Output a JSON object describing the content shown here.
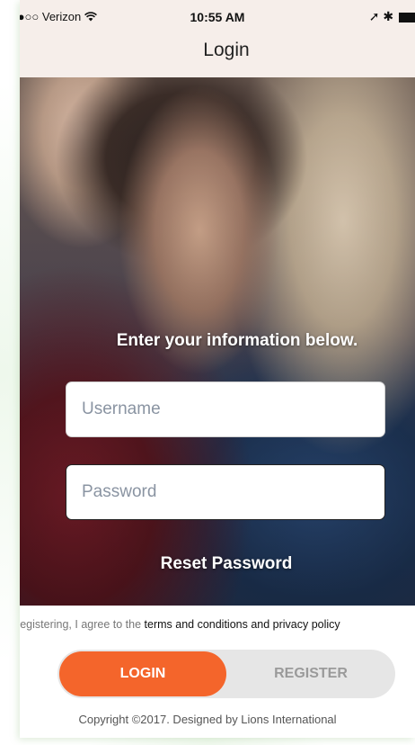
{
  "status_bar": {
    "carrier": "●●●○○ Verizon",
    "wifi_icon": "wifi-icon",
    "time": "10:55 AM",
    "location_icon": "➚",
    "bluetooth_icon": "✱"
  },
  "nav": {
    "title": "Login"
  },
  "form": {
    "heading": "Enter your information below.",
    "username_placeholder": "Username",
    "username_value": "",
    "password_placeholder": "Password",
    "password_value": "",
    "reset_label": "Reset Password"
  },
  "terms": {
    "prefix": "By registering, I agree to the ",
    "link": "terms and conditions and privacy policy"
  },
  "toggle": {
    "login_label": "LOGIN",
    "register_label": "REGISTER",
    "active": "login"
  },
  "footer": {
    "copyright": "Copyright ©2017. Designed by Lions International"
  },
  "colors": {
    "accent": "#f4652b",
    "nav_bg": "#f6eeea",
    "toggle_bg": "#e6e6e6"
  }
}
